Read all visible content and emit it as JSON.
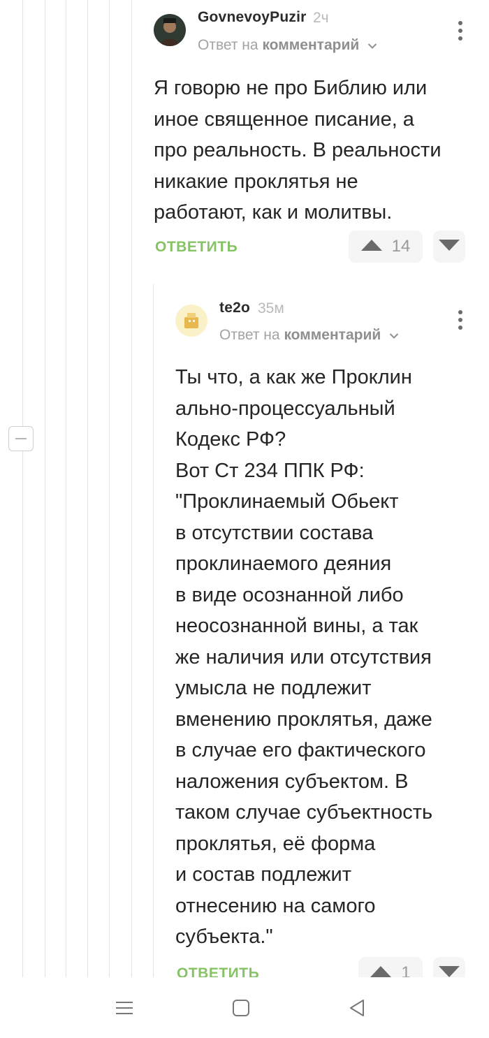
{
  "comments": [
    {
      "username": "GovnevoyPuzir",
      "time": "2ч",
      "reply_prefix": "Ответ на",
      "reply_target": "комментарий",
      "text": "Я говорю не про Библию или\nиное священное писание, а\nпро реальность. В реальности\nникакие проклятья не\nработают, как и молитвы.",
      "reply_label": "ОТВЕТИТЬ",
      "votes": "14"
    },
    {
      "username": "te2o",
      "time": "35м",
      "reply_prefix": "Ответ на",
      "reply_target": "комментарий",
      "text": "Ты что, а как же Проклин\nально-процессуальный\nКодекс РФ?\nВот Ст 234 ППК РФ:\n\"Проклинаемый Обьект\nв отсутствии состава\nпроклинаемого деяния\nв виде осознанной либо\nнеосознанной вины, а так\nже наличия или отсутствия\nумысла не подлежит\nвменению проклятья, даже\nв случае его фактического\nналожения субъектом. В\nтаком случае субъектность\nпроклятья, её форма\nи состав подлежит\nотнесению на самого\nсубъекта.\"",
      "reply_label": "ОТВЕТИТЬ",
      "votes": "1"
    }
  ],
  "icons": {
    "upvote": "arrow-up-icon",
    "downvote": "arrow-down-icon",
    "more": "more-vertical-icon",
    "collapse": "minus-icon",
    "nav_menu": "menu-icon",
    "nav_home": "home-square-icon",
    "nav_back": "back-triangle-icon"
  },
  "colors": {
    "accent": "#86c365",
    "thread_line": "#e3e3e3",
    "muted": "#a3a3a3"
  }
}
